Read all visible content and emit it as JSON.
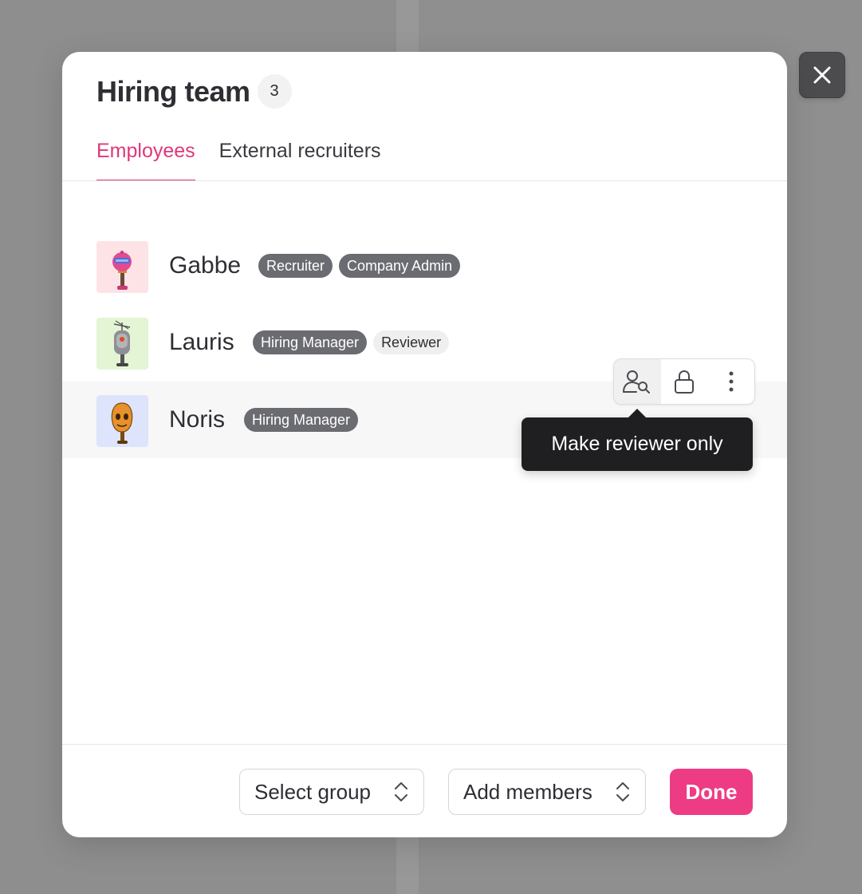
{
  "modal": {
    "title": "Hiring team",
    "member_count": "3"
  },
  "tabs": [
    {
      "label": "Employees",
      "active": true
    },
    {
      "label": "External recruiters",
      "active": false
    }
  ],
  "members": [
    {
      "name": "Gabbe",
      "roles": [
        "Recruiter",
        "Company Admin"
      ],
      "avatar_icon": "pink-robot-avatar"
    },
    {
      "name": "Lauris",
      "roles": [
        "Hiring Manager",
        "Reviewer"
      ],
      "avatar_icon": "gray-robot-avatar"
    },
    {
      "name": "Noris",
      "roles": [
        "Hiring Manager"
      ],
      "avatar_icon": "orange-robot-avatar"
    }
  ],
  "row_actions": {
    "icons": [
      "reviewer-search-icon",
      "lock-icon",
      "more-vertical-icon"
    ]
  },
  "tooltip": {
    "text": "Make reviewer only"
  },
  "footer": {
    "select_group_label": "Select group",
    "add_members_label": "Add members",
    "done_label": "Done"
  },
  "colors": {
    "accent": "#e0377a",
    "primary_button": "#ee3c84",
    "chip_dark": "#6b6b72",
    "chip_light": "#efefef",
    "tooltip_bg": "#1f1f22"
  }
}
